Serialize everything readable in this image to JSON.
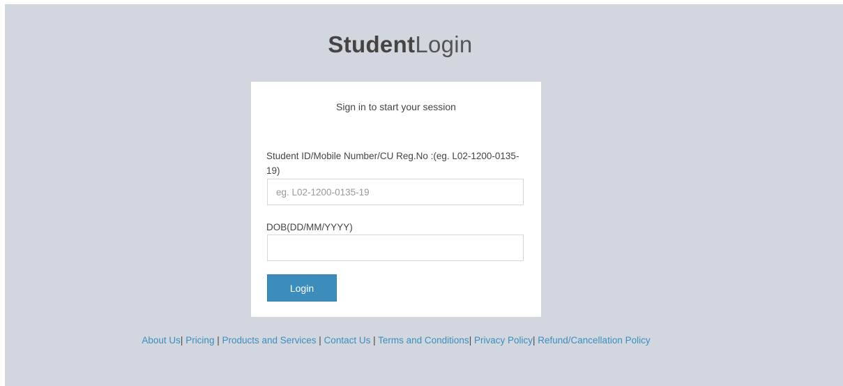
{
  "logo": {
    "bold": "Student",
    "light": "Login"
  },
  "login_box": {
    "message": "Sign in to start your session",
    "student_id": {
      "label": "Student ID/Mobile Number/CU Reg.No :(eg. L02-1200-0135-19)",
      "placeholder": "eg. L02-1200-0135-19",
      "value": ""
    },
    "dob": {
      "label": "DOB(DD/MM/YYYY)",
      "placeholder": "",
      "value": ""
    },
    "login_label": "Login"
  },
  "footer": {
    "links": [
      "About Us",
      "Pricing",
      "Products and Services",
      "Contact Us",
      "Terms and Conditions",
      "Privacy Policy",
      "Refund/Cancellation Policy"
    ]
  },
  "colors": {
    "background": "#d2d6de",
    "accent": "#3c8dbc",
    "text": "#444444"
  }
}
